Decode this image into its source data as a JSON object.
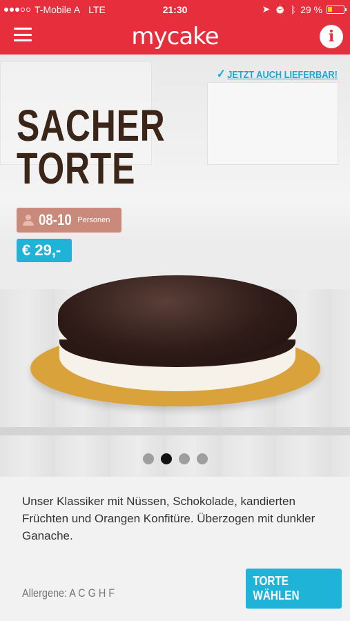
{
  "status_bar": {
    "carrier": "T-Mobile A",
    "network": "LTE",
    "time": "21:30",
    "battery": "29 %",
    "battery_level": 0.29,
    "icons": [
      "location-arrow-icon",
      "alarm-icon",
      "bluetooth-icon"
    ]
  },
  "header": {
    "logo": "mycake",
    "menu_icon": "hamburger-menu-icon",
    "info_label": "i",
    "brand_color": "#e62e3c"
  },
  "hero": {
    "delivery_label": "JETZT AUCH LIEFERBAR!",
    "title_line1": "SACHER",
    "title_line2": "TORTE",
    "persons_value": "08-10",
    "persons_unit": "Personen",
    "price": "€ 29,-",
    "accent_color": "#1fb3d8"
  },
  "pager": {
    "count": 4,
    "active_index": 1
  },
  "details": {
    "description": "Unser Klassiker mit Nüssen, Schokolade, kandierten Früchten und Orangen Konfitüre. Überzogen mit dunkler Ganache.",
    "allergens": "Allergene: A C G H F",
    "cta_label": "TORTE WÄHLEN"
  }
}
